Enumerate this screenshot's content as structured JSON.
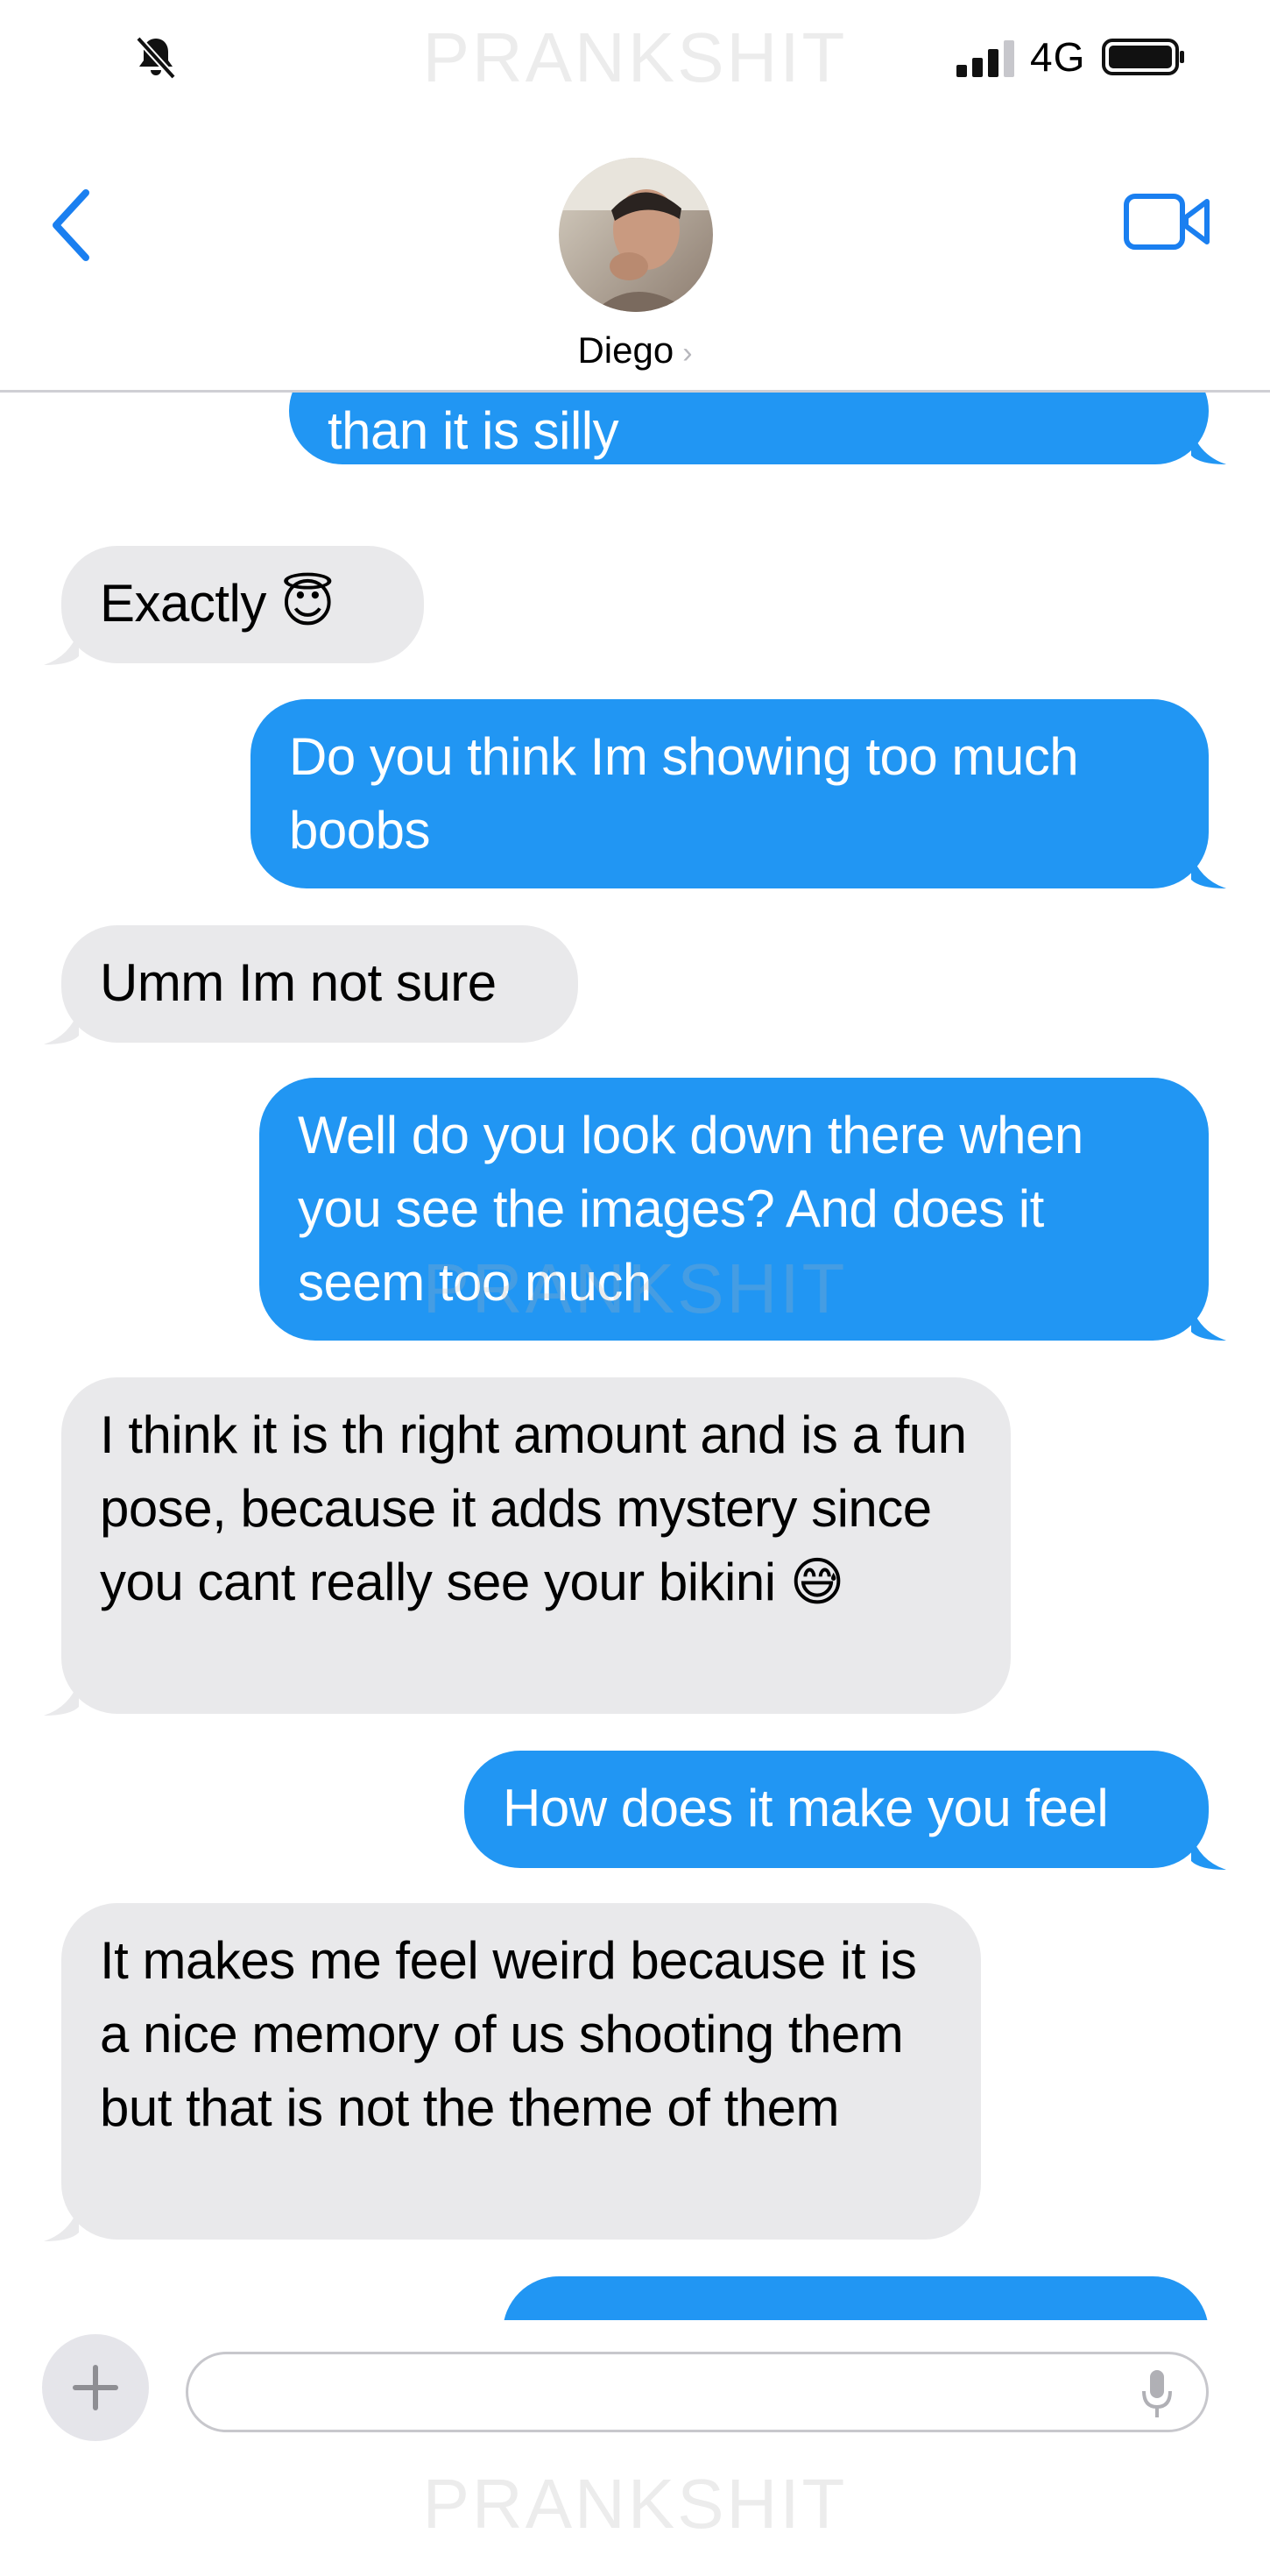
{
  "status_bar": {
    "network": "4G",
    "icons": [
      "bell-slash-icon",
      "signal-icon",
      "battery-icon"
    ]
  },
  "header": {
    "contact_name": "Diego",
    "chevron": "›",
    "icons": [
      "back-chevron-icon",
      "video-call-icon"
    ]
  },
  "messages": [
    {
      "dir": "out",
      "text": "than it is silly"
    },
    {
      "dir": "in",
      "text": "Exactly 😇"
    },
    {
      "dir": "out",
      "text": "Do you think Im showing too much boobs"
    },
    {
      "dir": "in",
      "text": "Umm Im not sure"
    },
    {
      "dir": "out",
      "text": "Well do you look down there when you see the images? And does it seem too much"
    },
    {
      "dir": "in",
      "text": "I think it is th right amount and is a fun pose, because it adds mystery since you cant really see your bikini 😅"
    },
    {
      "dir": "out",
      "text": "How does it make you feel"
    },
    {
      "dir": "in",
      "text": "It makes me feel weird because it is a nice memory of us shooting them but that is not the theme of them"
    }
  ],
  "input": {
    "placeholder": "",
    "plus_label": "+",
    "icons": [
      "plus-icon",
      "microphone-icon"
    ]
  },
  "watermark": "PRANKSHIT",
  "colors": {
    "outgoing": "#2196f3",
    "incoming": "#e9e9eb",
    "accent": "#1a7ff0"
  }
}
